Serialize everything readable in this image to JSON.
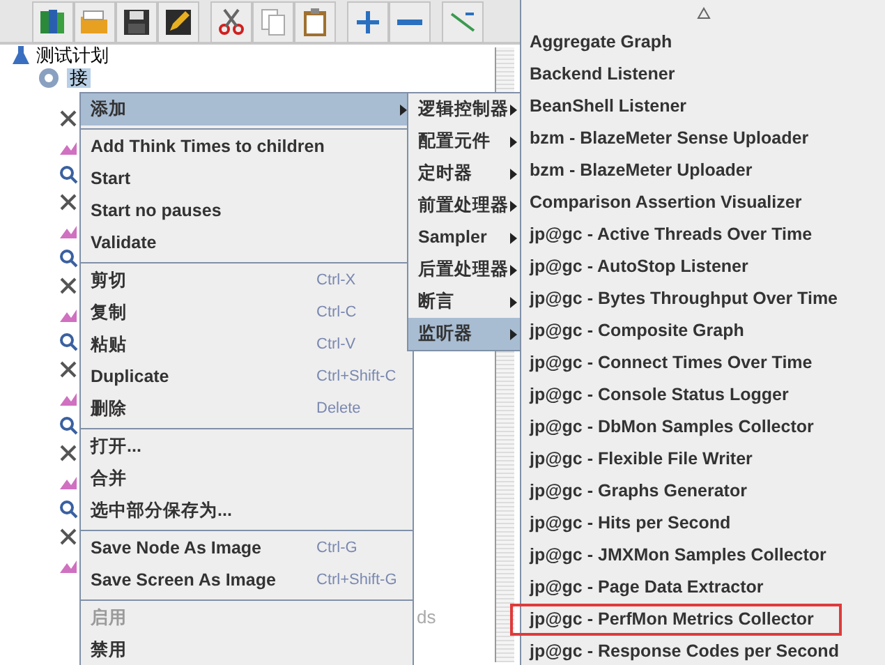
{
  "tree": {
    "items": [
      {
        "label": "测试计划",
        "selected": false
      },
      {
        "label": "接",
        "selected": true
      }
    ],
    "hidden_fragment": "ds"
  },
  "context_menu": {
    "items": [
      {
        "kind": "submenu",
        "label": "添加",
        "selected": true,
        "disabled": false
      },
      {
        "kind": "separator"
      },
      {
        "kind": "item",
        "label": "Add Think Times to children",
        "selected": false,
        "disabled": false
      },
      {
        "kind": "item",
        "label": "Start",
        "selected": false,
        "disabled": false
      },
      {
        "kind": "item",
        "label": "Start no pauses",
        "selected": false,
        "disabled": false
      },
      {
        "kind": "item",
        "label": "Validate",
        "selected": false,
        "disabled": false
      },
      {
        "kind": "separator"
      },
      {
        "kind": "item",
        "label": "剪切",
        "shortcut": "Ctrl-X",
        "selected": false,
        "disabled": false
      },
      {
        "kind": "item",
        "label": "复制",
        "shortcut": "Ctrl-C",
        "selected": false,
        "disabled": false
      },
      {
        "kind": "item",
        "label": "粘贴",
        "shortcut": "Ctrl-V",
        "selected": false,
        "disabled": false
      },
      {
        "kind": "item",
        "label": "Duplicate",
        "shortcut": "Ctrl+Shift-C",
        "selected": false,
        "disabled": false
      },
      {
        "kind": "item",
        "label": "删除",
        "shortcut": "Delete",
        "selected": false,
        "disabled": false
      },
      {
        "kind": "separator"
      },
      {
        "kind": "item",
        "label": "打开...",
        "selected": false,
        "disabled": false
      },
      {
        "kind": "item",
        "label": "合并",
        "selected": false,
        "disabled": false
      },
      {
        "kind": "item",
        "label": "选中部分保存为...",
        "selected": false,
        "disabled": false
      },
      {
        "kind": "separator"
      },
      {
        "kind": "item",
        "label": "Save Node As Image",
        "shortcut": "Ctrl-G",
        "selected": false,
        "disabled": false
      },
      {
        "kind": "item",
        "label": "Save Screen As Image",
        "shortcut": "Ctrl+Shift-G",
        "selected": false,
        "disabled": false
      },
      {
        "kind": "separator"
      },
      {
        "kind": "item",
        "label": "启用",
        "selected": false,
        "disabled": true
      },
      {
        "kind": "item",
        "label": "禁用",
        "selected": false,
        "disabled": false
      }
    ]
  },
  "add_submenu": {
    "items": [
      {
        "label": "逻辑控制器",
        "selected": false
      },
      {
        "label": "配置元件",
        "selected": false
      },
      {
        "label": "定时器",
        "selected": false
      },
      {
        "label": "前置处理器",
        "selected": false
      },
      {
        "label": "Sampler",
        "selected": false
      },
      {
        "label": "后置处理器",
        "selected": false
      },
      {
        "label": "断言",
        "selected": false
      },
      {
        "label": "监听器",
        "selected": true
      }
    ]
  },
  "listener_menu": {
    "items": [
      {
        "label": "Aggregate Graph",
        "highlighted": false
      },
      {
        "label": "Backend Listener",
        "highlighted": false
      },
      {
        "label": "BeanShell Listener",
        "highlighted": false
      },
      {
        "label": "bzm - BlazeMeter Sense Uploader",
        "highlighted": false
      },
      {
        "label": "bzm - BlazeMeter Uploader",
        "highlighted": false
      },
      {
        "label": "Comparison Assertion Visualizer",
        "highlighted": false
      },
      {
        "label": "jp@gc - Active Threads Over Time",
        "highlighted": false
      },
      {
        "label": "jp@gc - AutoStop Listener",
        "highlighted": false
      },
      {
        "label": "jp@gc - Bytes Throughput Over Time",
        "highlighted": false
      },
      {
        "label": "jp@gc - Composite Graph",
        "highlighted": false
      },
      {
        "label": "jp@gc - Connect Times Over Time",
        "highlighted": false
      },
      {
        "label": "jp@gc - Console Status Logger",
        "highlighted": false
      },
      {
        "label": "jp@gc - DbMon Samples Collector",
        "highlighted": false
      },
      {
        "label": "jp@gc - Flexible File Writer",
        "highlighted": false
      },
      {
        "label": "jp@gc - Graphs Generator",
        "highlighted": false
      },
      {
        "label": "jp@gc - Hits per Second",
        "highlighted": false
      },
      {
        "label": "jp@gc - JMXMon Samples Collector",
        "highlighted": false
      },
      {
        "label": "jp@gc - Page Data Extractor",
        "highlighted": false
      },
      {
        "label": "jp@gc - PerfMon Metrics Collector",
        "highlighted": true
      },
      {
        "label": "jp@gc - Response Codes per Second",
        "highlighted": false
      }
    ]
  }
}
